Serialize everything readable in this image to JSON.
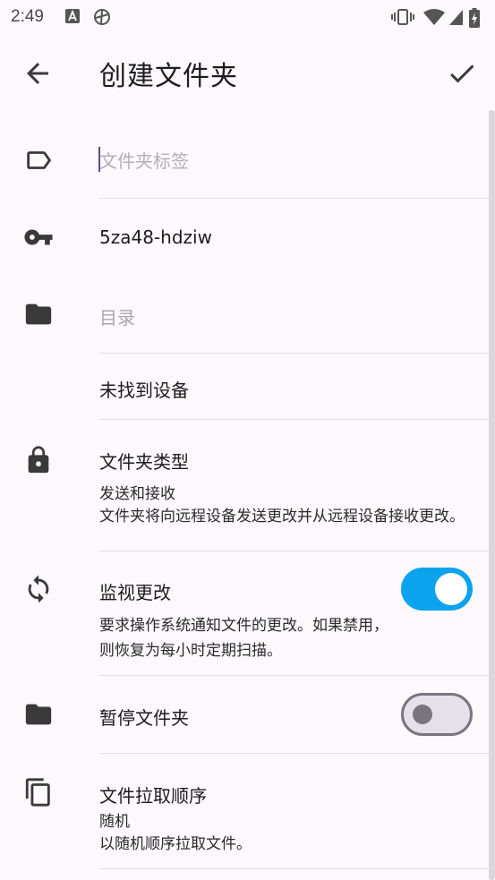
{
  "status_bar": {
    "time": "2:49"
  },
  "app_bar": {
    "title": "创建文件夹"
  },
  "form": {
    "folder_label": {
      "placeholder": "文件夹标签",
      "value": ""
    },
    "folder_id": {
      "value": "5za48-hdziw"
    },
    "directory": {
      "placeholder": "目录"
    },
    "devices": {
      "text": "未找到设备"
    },
    "folder_type": {
      "title": "文件夹类型",
      "value": "发送和接收",
      "description": "文件夹将向远程设备发送更改并从远程设备接收更改。"
    },
    "watch_changes": {
      "title": "监视更改",
      "description_line1": "要求操作系统通知文件的更改。如果禁用，",
      "description_line2": "则恢复为每小时定期扫描。",
      "enabled": true
    },
    "pause_folder": {
      "title": "暂停文件夹",
      "enabled": false
    },
    "pull_order": {
      "title": "文件拉取顺序",
      "value": "随机",
      "description": "以随机顺序拉取文件。"
    }
  },
  "colors": {
    "toggle_on": "#0ba3ee",
    "background": "#fdf8fc"
  }
}
